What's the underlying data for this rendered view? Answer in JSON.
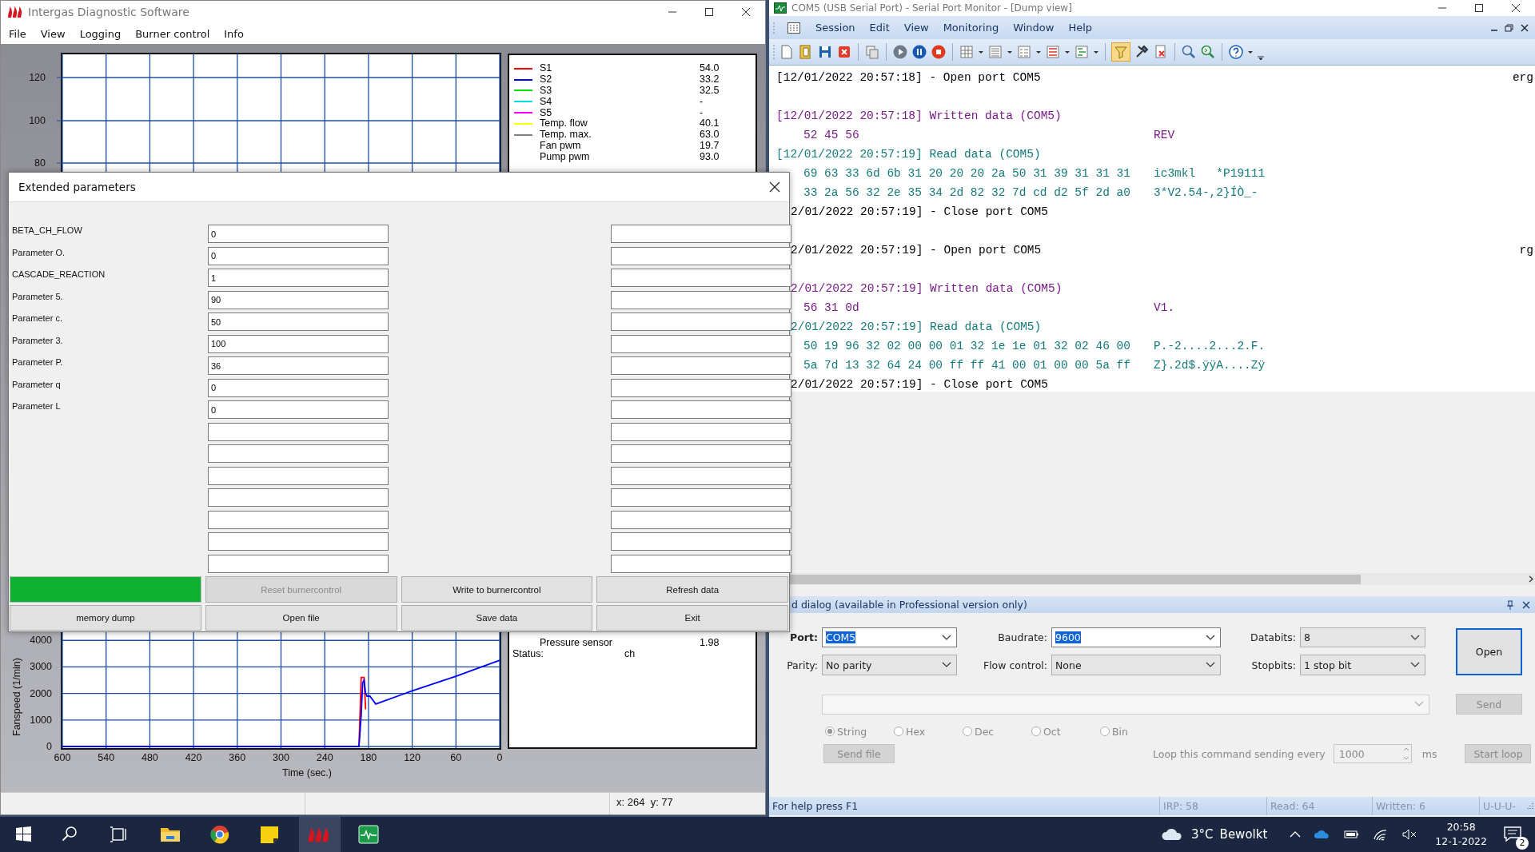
{
  "intergas_window": {
    "title": "Intergas Diagnostic Software",
    "menu": [
      "File",
      "View",
      "Logging",
      "Burner control",
      "Info"
    ],
    "top_chart": {
      "y_labels": [
        "120",
        "100",
        "80"
      ]
    },
    "top_legend": [
      {
        "label": "S1",
        "value": "54.0",
        "color": "#ff0000"
      },
      {
        "label": "S2",
        "value": "33.2",
        "color": "#0000ff"
      },
      {
        "label": "S3",
        "value": "32.5",
        "color": "#00e000"
      },
      {
        "label": "S4",
        "value": "-",
        "color": "#00e0e0"
      },
      {
        "label": "S5",
        "value": "-",
        "color": "#ff00ff"
      },
      {
        "label": "Temp. flow",
        "value": "40.1",
        "color": "#ffff00"
      },
      {
        "label": "Temp. max.",
        "value": "63.0",
        "color": "#808080"
      },
      {
        "label": "Fan pwm",
        "value": "19.7"
      },
      {
        "label": "Pump pwm",
        "value": "93.0"
      }
    ],
    "bottom_chart": {
      "chart_data": {
        "type": "line",
        "xlabel": "Time (sec.)",
        "ylabel": "Fanspeed (1/min)",
        "x": [
          600,
          195,
          193,
          190,
          188,
          186,
          184,
          182,
          178,
          170,
          120,
          60,
          0
        ],
        "series": [
          {
            "color": "#ff0000",
            "values": [
              null,
              null,
              0,
              2600,
              2600,
              2600,
              1400,
              null,
              null,
              null,
              null,
              null,
              null
            ]
          },
          {
            "color": "#0000ff",
            "values": [
              0,
              0,
              0,
              1200,
              2400,
              2500,
              2000,
              1900,
              1900,
              1600,
              2100,
              2650,
              3250
            ]
          }
        ],
        "grid": true,
        "xlim": [
          600,
          0
        ],
        "ylim": [
          0,
          4400
        ],
        "xticks": [
          600,
          540,
          480,
          420,
          360,
          300,
          240,
          180,
          120,
          60,
          0
        ],
        "yticks": [
          0,
          1000,
          2000,
          3000,
          4000
        ]
      }
    },
    "bottom_legend": [
      {
        "label": "Pressure sensor",
        "value": "1.98"
      }
    ],
    "status": {
      "label": "Status:",
      "value": "ch"
    },
    "cursor": "x: 264  y: 77"
  },
  "extended_parameters": {
    "title": "Extended parameters",
    "rows": [
      {
        "label": "BETA_CH_FLOW",
        "value": "0"
      },
      {
        "label": "Parameter O.",
        "value": "0"
      },
      {
        "label": "CASCADE_REACTION",
        "value": "1"
      },
      {
        "label": "Parameter 5.",
        "value": "90"
      },
      {
        "label": "Parameter c.",
        "value": "50"
      },
      {
        "label": "Parameter 3.",
        "value": "100"
      },
      {
        "label": "Parameter P.",
        "value": "36"
      },
      {
        "label": "Parameter q",
        "value": "0"
      },
      {
        "label": "Parameter L",
        "value": "0"
      }
    ],
    "progress": {
      "level": 1
    },
    "buttons": [
      {
        "label": "Reset burnercontrol",
        "disabled": true
      },
      {
        "label": "Write to burnercontrol",
        "disabled": false
      },
      {
        "label": "Refresh data",
        "disabled": false
      },
      {
        "label": "memory dump",
        "disabled": false
      },
      {
        "label": "Open file",
        "disabled": false
      },
      {
        "label": "Save data",
        "disabled": false
      },
      {
        "label": "Exit",
        "disabled": false
      }
    ]
  },
  "monitor_window": {
    "title": "COM5 (USB Serial Port) - Serial Port Monitor - [Dump view]",
    "menu": [
      "Session",
      "Edit",
      "View",
      "Monitoring",
      "Window",
      "Help"
    ],
    "toolbar": {
      "filter_on": true
    },
    "dump_lines": [
      {
        "kind": "event",
        "text": "[12/01/2022 20:57:18] - Open port COM5",
        "cut_off": false,
        "overflow": "erg"
      },
      {
        "kind": "gap"
      },
      {
        "kind": "written",
        "text": "[12/01/2022 20:57:18] Written data (COM5)",
        "cut_off": false
      },
      {
        "kind": "written-data",
        "hex": "52 45 56",
        "ascii": "REV"
      },
      {
        "kind": "read",
        "text": "[12/01/2022 20:57:19] Read data (COM5)",
        "cut_off": false
      },
      {
        "kind": "read-data",
        "hex": "69 63 33 6d 6b 31 20 20 20 2a 50 31 39 31 31 31",
        "ascii": "ic3mkl   *P19111"
      },
      {
        "kind": "read-data",
        "hex": "33 2a 56 32 2e 35 34 2d 82 32 7d cd d2 5f 2d a0",
        "ascii": "3*V2.54-,2}ÍÒ_-"
      },
      {
        "kind": "event",
        "text": "2/01/2022 20:57:19] - Close port COM5",
        "cut_off": true
      },
      {
        "kind": "gap"
      },
      {
        "kind": "event",
        "text": "2/01/2022 20:57:19] - Open port COM5",
        "cut_off": true,
        "overflow": "rg"
      },
      {
        "kind": "gap"
      },
      {
        "kind": "written",
        "text": "2/01/2022 20:57:19] Written data (COM5)",
        "cut_off": true
      },
      {
        "kind": "written-data",
        "hex": "56 31 0d",
        "ascii": "V1."
      },
      {
        "kind": "read",
        "text": "2/01/2022 20:57:19] Read data (COM5)",
        "cut_off": true
      },
      {
        "kind": "read-data",
        "hex": "50 19 96 32 02 00 00 01 32 1e 1e 01 32 02 46 00",
        "ascii": "P.-2....2...2.F."
      },
      {
        "kind": "read-data",
        "hex": "5a 7d 13 32 64 24 00 ff ff 41 00 01 00 00 5a ff",
        "ascii": "Z}.2d$.ÿÿA....Zÿ"
      },
      {
        "kind": "event",
        "text": "2/01/2022 20:57:19] - Close port COM5",
        "cut_off": true
      }
    ],
    "panel_title": "d dialog (available in Professional version only)",
    "settings": [
      {
        "label": "Port:",
        "value": "COM5",
        "kind": "edit",
        "highlighted": true,
        "bold": true
      },
      {
        "label": "Baudrate:",
        "value": "9600",
        "kind": "edit",
        "highlighted": true,
        "bold": false
      },
      {
        "label": "Databits:",
        "value": "8",
        "kind": "list",
        "highlighted": false,
        "bold": false
      },
      {
        "label": "Parity:",
        "value": "No parity",
        "kind": "list",
        "highlighted": false,
        "bold": false
      },
      {
        "label": "Flow control:",
        "value": "None",
        "kind": "list",
        "highlighted": false,
        "bold": false
      },
      {
        "label": "Stopbits:",
        "value": "1 stop bit",
        "kind": "list",
        "highlighted": false,
        "bold": false
      }
    ],
    "open_button": {
      "label": "Open",
      "disabled": false
    },
    "send_button": {
      "label": "Send",
      "disabled": true
    },
    "formats": [
      {
        "label": "String",
        "selected": true
      },
      {
        "label": "Hex",
        "selected": false
      },
      {
        "label": "Dec",
        "selected": false
      },
      {
        "label": "Oct",
        "selected": false
      },
      {
        "label": "Bin",
        "selected": false
      }
    ],
    "send_file_button": {
      "label": "Send file",
      "disabled": true
    },
    "loop_label": "Loop this command sending every",
    "loop_interval": "1000",
    "loop_unit": "ms",
    "start_loop_button": {
      "label": "Start loop",
      "disabled": true
    },
    "status_bar": [
      "For help press F1",
      "IRP: 58",
      "Read: 64",
      "Written: 6",
      "U-U-U-"
    ]
  },
  "taskbar": {
    "apps": [
      {
        "selected": false
      },
      {
        "selected": false
      },
      {
        "selected": false
      },
      {
        "selected": true
      },
      {
        "selected": false
      }
    ],
    "temperature": "3°C",
    "weather": "Bewolkt",
    "time": "20:58",
    "date": "12-1-2022",
    "notifications": "2"
  }
}
